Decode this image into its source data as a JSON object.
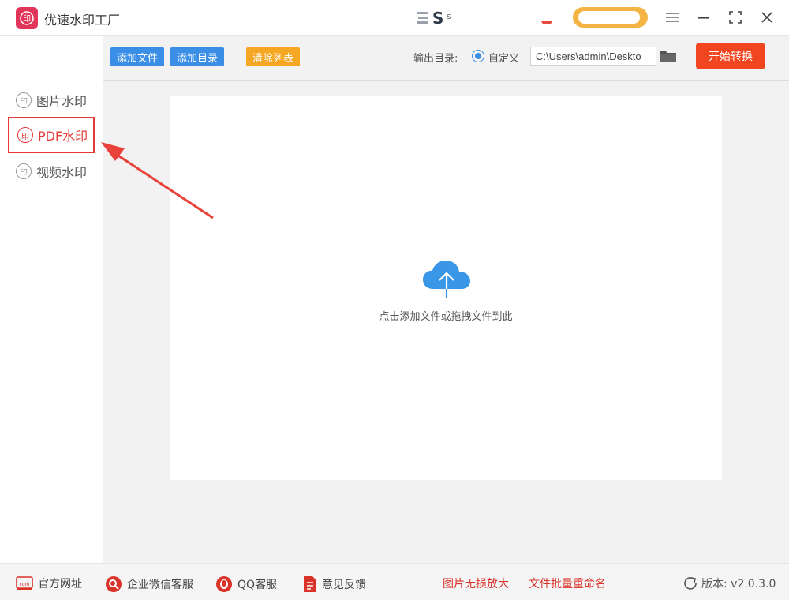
{
  "app": {
    "title": "优速水印工厂",
    "logo_char": "印"
  },
  "header": {
    "s_text": "s"
  },
  "sidebar": {
    "items": [
      {
        "label": "图片水印",
        "icon": "印"
      },
      {
        "label": "PDF水印",
        "icon": "印"
      },
      {
        "label": "视频水印",
        "icon": "印"
      }
    ]
  },
  "toolbar": {
    "add_file": "添加文件",
    "add_dir": "添加目录",
    "clear_list": "清除列表",
    "output_label": "输出目录:",
    "custom_label": "自定义",
    "output_path": "C:\\Users\\admin\\Deskto",
    "start": "开始转换"
  },
  "dropzone": {
    "hint": "点击添加文件或拖拽文件到此"
  },
  "footer": {
    "website": "官方网址",
    "wechat": "企业微信客服",
    "qq": "QQ客服",
    "feedback": "意见反馈",
    "lossless": "图片无损放大",
    "rename": "文件批量重命名",
    "version": "版本: v2.0.3.0"
  },
  "colors": {
    "accent_blue": "#3a8ee6",
    "accent_orange": "#f5a623",
    "start_red": "#f0451e",
    "active_red": "#e53935"
  }
}
